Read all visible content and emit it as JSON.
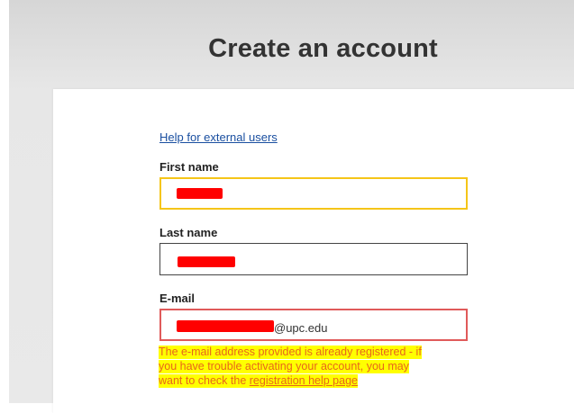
{
  "page": {
    "title": "Create an account"
  },
  "form": {
    "help_link": "Help for external users",
    "first_name": {
      "label": "First name"
    },
    "last_name": {
      "label": "Last name"
    },
    "email": {
      "label": "E-mail",
      "suffix": "@upc.edu"
    },
    "error": {
      "line1": "The e-mail address provided is already registered - if",
      "line2": "you have trouble activating your account, you may",
      "line3_prefix": "want to check the ",
      "link": "registration help page"
    }
  },
  "colors": {
    "focus_border": "#f5c518",
    "error_border": "#e05a5a",
    "error_text": "#e8651a",
    "highlight": "#ffff00",
    "redaction": "#ff0000",
    "link": "#1a4fa0"
  }
}
